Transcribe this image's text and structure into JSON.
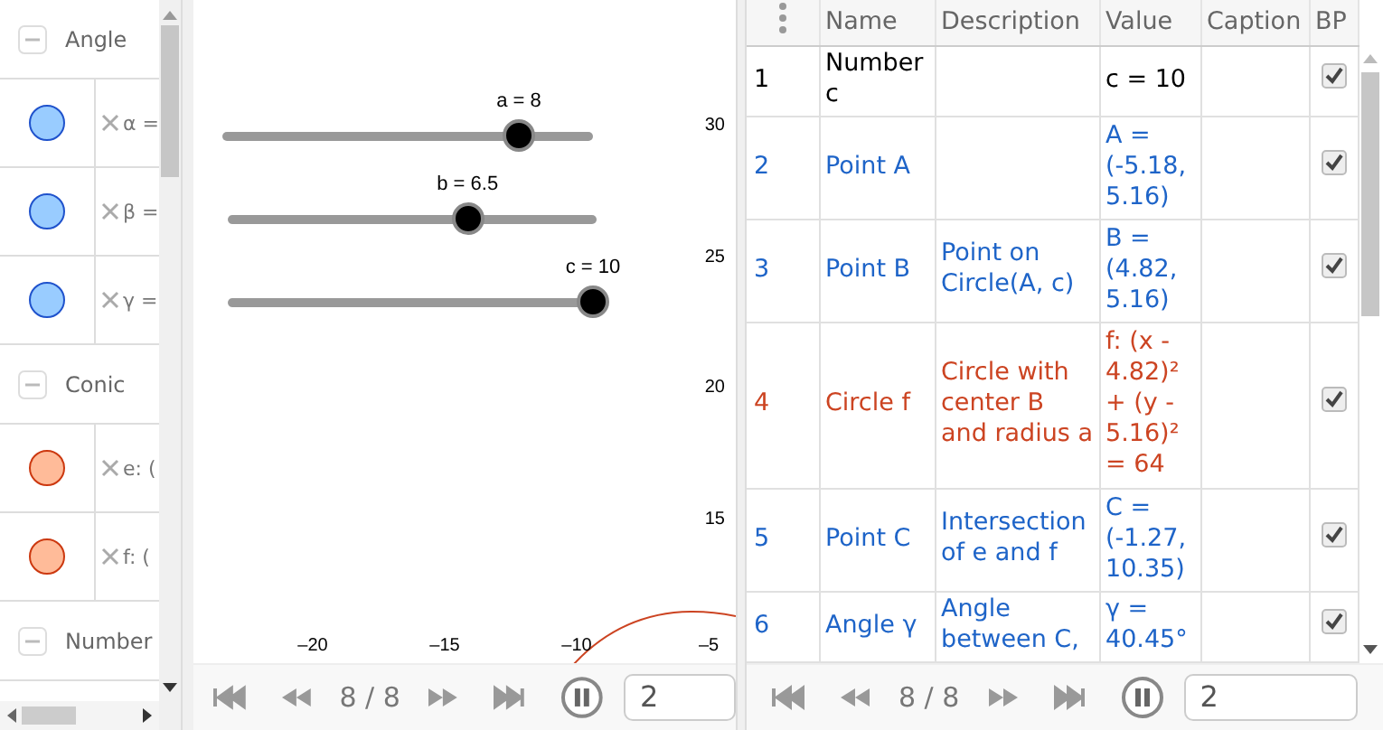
{
  "algebra_view": {
    "groups": [
      {
        "label": "Angle",
        "expanded": true,
        "items": [
          {
            "color": "#99ccff",
            "label": "α ="
          },
          {
            "color": "#99ccff",
            "label": "β ="
          },
          {
            "color": "#99ccff",
            "label": "γ ="
          }
        ]
      },
      {
        "label": "Conic",
        "expanded": true,
        "items": [
          {
            "color": "#ffbb99",
            "label": "e: ("
          },
          {
            "color": "#ffbb99",
            "label": "f: ("
          }
        ]
      },
      {
        "label": "Number",
        "expanded": true
      }
    ]
  },
  "graphics_view": {
    "sliders": [
      {
        "label": "a = 8",
        "level": 0.8
      },
      {
        "label": "b = 6.5",
        "level": 0.65
      },
      {
        "label": "c = 10",
        "level": 1.0
      }
    ],
    "x_axis_labels": [
      "–20",
      "–15",
      "–10",
      "–5"
    ],
    "y_axis_labels": [
      "30",
      "25",
      "20",
      "15"
    ],
    "playback": {
      "frame": "8 / 8",
      "playing": true,
      "speed": "2"
    }
  },
  "construction_protocol": {
    "columns": [
      "Name",
      "Description",
      "Value",
      "Caption",
      "BP"
    ],
    "rows": [
      {
        "number": "1",
        "name": "Number c",
        "value": "c = 10",
        "breakpoint": true,
        "color": "#000000"
      },
      {
        "number": "2",
        "name": "Point A",
        "value": "A = (-5.18, 5.16)",
        "breakpoint": true,
        "color": "#1e64c8"
      },
      {
        "number": "3",
        "name": "Point B",
        "description": "Point on Circle(A, c)",
        "value": "B = (4.82, 5.16)",
        "breakpoint": true,
        "color": "#1e64c8"
      },
      {
        "number": "4",
        "name": "Circle f",
        "description": "Circle with center B and radius a",
        "value": "f: (x - 4.82)² + (y - 5.16)² = 64",
        "breakpoint": true,
        "color": "#cc4422"
      },
      {
        "number": "5",
        "name": "Point C",
        "description": "Intersection of e and f",
        "value": "C = (-1.27, 10.35)",
        "breakpoint": true,
        "color": "#1e64c8"
      },
      {
        "number": "6",
        "name": "Angle γ",
        "description": "Angle between C,",
        "value": "γ = 40.45°",
        "breakpoint": true,
        "color": "#1e64c8"
      }
    ],
    "playback": {
      "frame": "8 / 8",
      "playing": true,
      "speed": "2"
    }
  }
}
